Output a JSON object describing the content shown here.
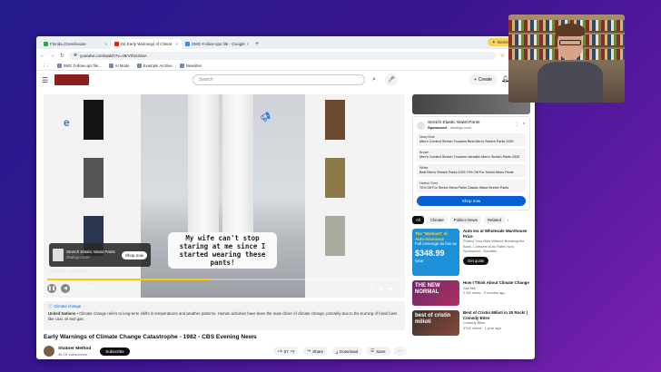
{
  "browser": {
    "tabs": [
      {
        "label": "Florida Greenhouse",
        "active": false
      },
      {
        "label": "(5) Early Warnings of Climat",
        "active": true
      },
      {
        "label": "SMG Follow-ups file - Google",
        "active": false
      }
    ],
    "gemini_label": "Gemini",
    "url": "youtube.com/watch?v=45rVrhm3zaA",
    "bookmarks": [
      "SMG Follow-ups file...",
      "AI Mode",
      "Example Archive",
      "Newsites"
    ]
  },
  "youtube": {
    "search_placeholder": "Search",
    "create_label": "Create"
  },
  "player": {
    "caption": "My wife can't stop staring at me since I started wearing these pants!",
    "ad_title": "Stretch Elastic Waist Pants",
    "ad_domain": "dsalego.com",
    "shop_now": "Shop now",
    "ad_sub": "Sponsored · dsalego.com",
    "progress_fraction": 0.46,
    "time": "0:07 / 0:30"
  },
  "info": {
    "link": "Climate change",
    "source": "United Nations",
    "text": " • Climate change refers to long-term shifts in temperatures and weather patterns. Human activities have been the main driver of climate change, primarily due to the burning of fossil fuels like coal, oil and gas."
  },
  "video": {
    "title": "Early Warnings of Climate Change Catastrophe - 1982 - CBS Evening News",
    "channel": "Shatner Method",
    "subs": "46.1K subscribers",
    "subscribe": "Subscribe",
    "likes": "57",
    "share": "Share",
    "download": "Download",
    "save": "Save"
  },
  "sidebar": {
    "ad_title": "Stretch Elastic Waist Pants",
    "sponsored": "Sponsored",
    "domain": "dsalego.com",
    "options": [
      {
        "name": "Navy Blue",
        "desc": "Men's Comfort Stretch Trousers Best Men's Stretch Pants 2025"
      },
      {
        "name": "Brown",
        "desc": "Men's Comfort Stretch Trousers Versatile Men's Stretch Pants 2025"
      },
      {
        "name": "White",
        "desc": "Best Men's Stretch Pants 2025 70% Off For Senior Mens Pants"
      },
      {
        "name": "Harbor Grey",
        "desc": "70% Off For Senior Mens Pants Classic Waist Stretch Pants"
      }
    ],
    "shop_now": "Shop now",
    "chips": [
      "All",
      "Climate",
      "Politics News",
      "Related"
    ],
    "recs": [
      {
        "thumb_line1": "The \"Walmart\" of",
        "thumb_line2": "Auto Insurance",
        "thumb_line3": "Full coverage as low as",
        "thumb_price": "$348.99",
        "thumb_unit": "/year",
        "title": "Auto Ins at Wholesale Warehouse Price",
        "desc": "Protect Your Ride Without Breaking the Bank. Compare Auto Rates Now",
        "meta": "Sponsored · Solvable",
        "cta": "Get quote"
      },
      {
        "thumb": "THE NEW NORMAL",
        "title": "How I Think About Climate Change",
        "channel": "StarTalk",
        "meta": "2.1M views · 9 months ago"
      },
      {
        "thumb": "best of cristin milioti",
        "title": "Best of Cristin Milioti in 30 Rock! | Comedy Bites",
        "channel": "Comedy Bites",
        "meta": "472K views · 1 year ago"
      }
    ]
  },
  "colors": {
    "accent_blue": "#065fd4",
    "progress": "#ffcc00",
    "background": "#3a1590"
  }
}
